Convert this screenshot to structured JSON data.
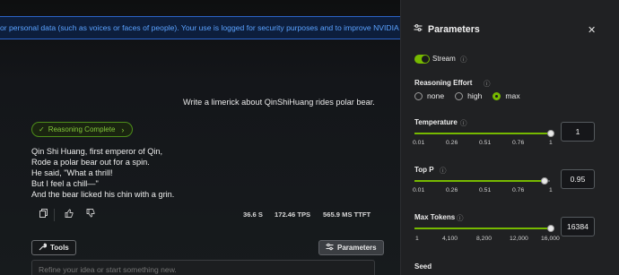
{
  "banner": {
    "text": "or personal data (such as voices or faces of people). Your use is logged for security purposes and to improve NVIDIA"
  },
  "chat": {
    "user_message": "Write a limerick about QinShiHuang rides polar bear.",
    "reasoning_chip": "Reasoning Complete",
    "answer_lines": [
      "Qin Shi Huang, first emperor of Qin,",
      "Rode a polar bear out for a spin.",
      "He said, \"What a thrill!",
      "But I feel a chill—\"",
      "And the bear licked his chin with a grin."
    ],
    "metrics": {
      "time": "36.6 S",
      "tps": "172.46 TPS",
      "ttft": "565.9 MS TTFT"
    }
  },
  "toolbar": {
    "tools_label": "Tools",
    "parameters_label": "Parameters"
  },
  "input": {
    "placeholder": "Refine your idea or start something new."
  },
  "panel": {
    "title": "Parameters",
    "stream": {
      "label": "Stream",
      "on": true
    },
    "reasoning_effort": {
      "label": "Reasoning Effort",
      "options": [
        "none",
        "high",
        "max"
      ],
      "selected": "max"
    },
    "temperature": {
      "label": "Temperature",
      "value": "1",
      "ticks": [
        "0.01",
        "0.26",
        "0.51",
        "0.76",
        "1"
      ],
      "fraction": 1.0
    },
    "top_p": {
      "label": "Top P",
      "value": "0.95",
      "ticks": [
        "0.01",
        "0.26",
        "0.51",
        "0.76",
        "1"
      ],
      "fraction": 0.95
    },
    "max_tokens": {
      "label": "Max Tokens",
      "value": "16384",
      "ticks": [
        "1",
        "4,100",
        "8,200",
        "12,000",
        "16,000"
      ],
      "fraction": 1.0
    },
    "seed": {
      "label": "Seed"
    }
  },
  "colors": {
    "accent": "#76b900",
    "banner_text": "#5aa2ff",
    "panel_bg": "#202123"
  }
}
